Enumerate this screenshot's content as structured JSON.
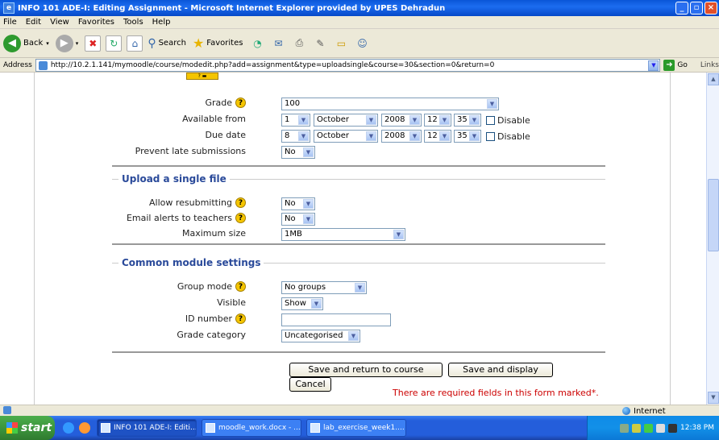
{
  "window": {
    "title": "INFO 101 ADE-I: Editing Assignment - Microsoft Internet Explorer provided by UPES Dehradun"
  },
  "menu": [
    "File",
    "Edit",
    "View",
    "Favorites",
    "Tools",
    "Help"
  ],
  "toolbar": {
    "back": "Back",
    "search": "Search",
    "favorites": "Favorites"
  },
  "address": {
    "label": "Address",
    "url": "http://10.2.1.141/mymoodle/course/modedit.php?add=assignment&type=uploadsingle&course=30&section=0&return=0",
    "go": "Go",
    "links": "Links"
  },
  "form": {
    "grade": {
      "label": "Grade",
      "value": "100"
    },
    "available_from": {
      "label": "Available from",
      "day": "1",
      "month": "October",
      "year": "2008",
      "hour": "12",
      "minute": "35",
      "disable": "Disable"
    },
    "due_date": {
      "label": "Due date",
      "day": "8",
      "month": "October",
      "year": "2008",
      "hour": "12",
      "minute": "35",
      "disable": "Disable"
    },
    "prevent_late": {
      "label": "Prevent late submissions",
      "value": "No"
    },
    "upload_section": {
      "legend": "Upload a single file",
      "allow_resubmit": {
        "label": "Allow resubmitting",
        "value": "No"
      },
      "email_alerts": {
        "label": "Email alerts to teachers",
        "value": "No"
      },
      "max_size": {
        "label": "Maximum size",
        "value": "1MB"
      }
    },
    "common_section": {
      "legend": "Common module settings",
      "group_mode": {
        "label": "Group mode",
        "value": "No groups"
      },
      "visible": {
        "label": "Visible",
        "value": "Show"
      },
      "id_number": {
        "label": "ID number",
        "value": ""
      },
      "grade_category": {
        "label": "Grade category",
        "value": "Uncategorised"
      }
    },
    "buttons": {
      "save_return": "Save and return to course",
      "save_display": "Save and display",
      "cancel": "Cancel"
    },
    "required_note": "There are required fields in this form marked*."
  },
  "status": {
    "zone": "Internet"
  },
  "taskbar": {
    "start": "start",
    "tasks": [
      "INFO 101 ADE-I: Editi...",
      "moodle_work.docx - ...",
      "lab_exercise_week1...."
    ],
    "clock": "12:38 PM"
  },
  "colors": {
    "legend": "#2a4a9a",
    "required": "#cc0000",
    "title_bar": "#0a56d8"
  }
}
